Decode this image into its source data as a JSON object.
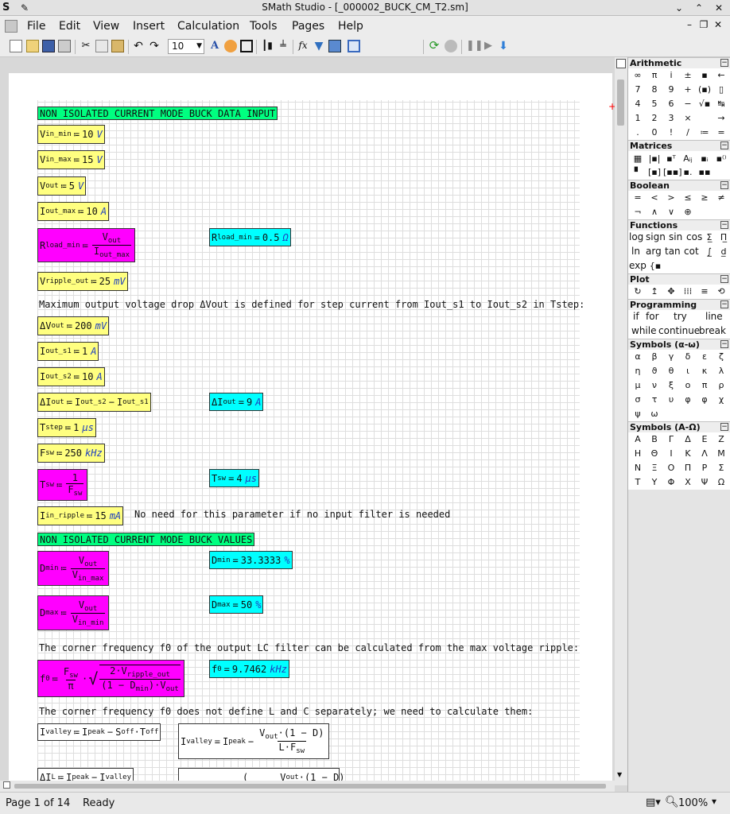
{
  "window": {
    "title": "SMath Studio - [_000002_BUCK_CM_T2.sm]"
  },
  "menu": [
    "File",
    "Edit",
    "View",
    "Insert",
    "Calculation",
    "Tools",
    "Pages",
    "Help"
  ],
  "toolbar": {
    "font_size": "10"
  },
  "sheet": {
    "header1": "NON ISOLATED CURRENT MODE BUCK DATA INPUT",
    "vin_min": {
      "base": "V",
      "sub": "in_min",
      "value": "10",
      "unit": "V"
    },
    "vin_max": {
      "base": "V",
      "sub": "in_max",
      "value": "15",
      "unit": "V"
    },
    "vout": {
      "base": "V",
      "sub": "out",
      "value": "5",
      "unit": "V"
    },
    "iout_max": {
      "base": "I",
      "sub": "out_max",
      "value": "10",
      "unit": "A"
    },
    "rload_def": {
      "base": "R",
      "sub": "load_min",
      "num_b": "V",
      "num_s": "out",
      "den_b": "I",
      "den_s": "out_max"
    },
    "rload_res": {
      "base": "R",
      "sub": "load_min",
      "value": "0.5",
      "unit": "Ω"
    },
    "vripple": {
      "base": "V",
      "sub": "ripple_out",
      "value": "25",
      "unit": "mV"
    },
    "text1": "Maximum output voltage drop ΔVout is defined for step current from Iout_s1 to Iout_s2 in Tstep:",
    "dvout": {
      "base": "ΔV",
      "sub": "out",
      "value": "200",
      "unit": "mV"
    },
    "iout_s1": {
      "base": "I",
      "sub": "out_s1",
      "value": "1",
      "unit": "A"
    },
    "iout_s2": {
      "base": "I",
      "sub": "out_s2",
      "value": "10",
      "unit": "A"
    },
    "diout_def": {
      "base": "ΔI",
      "sub": "out",
      "a_b": "I",
      "a_s": "out_s2",
      "b_b": "I",
      "b_s": "out_s1"
    },
    "diout_res": {
      "base": "ΔI",
      "sub": "out",
      "value": "9",
      "unit": "A"
    },
    "tstep": {
      "base": "T",
      "sub": "step",
      "value": "1",
      "unit": "μs"
    },
    "fsw": {
      "base": "F",
      "sub": "sw",
      "value": "250",
      "unit": "kHz"
    },
    "tsw_def": {
      "base": "T",
      "sub": "sw",
      "num": "1",
      "den_b": "F",
      "den_s": "sw"
    },
    "tsw_res": {
      "base": "T",
      "sub": "sw",
      "value": "4",
      "unit": "μs"
    },
    "iin_ripple": {
      "base": "I",
      "sub": "in_ripple",
      "value": "15",
      "unit": "mA"
    },
    "text2": "No need for this parameter if no input filter is needed",
    "header2": "NON ISOLATED CURRENT MODE BUCK VALUES",
    "dmin_def": {
      "base": "D",
      "sub": "min",
      "num_b": "V",
      "num_s": "out",
      "den_b": "V",
      "den_s": "in_max"
    },
    "dmin_res": {
      "base": "D",
      "sub": "min",
      "value": "33.3333",
      "unit": "%"
    },
    "dmax_def": {
      "base": "D",
      "sub": "max",
      "num_b": "V",
      "num_s": "out",
      "den_b": "V",
      "den_s": "in_min"
    },
    "dmax_res": {
      "base": "D",
      "sub": "max",
      "value": "50",
      "unit": "%"
    },
    "text3": "The corner frequency f0 of the output LC filter can be calculated from the max voltage ripple:",
    "f0_def": {
      "base": "f",
      "sub": "0",
      "fnum_b": "F",
      "fnum_s": "sw",
      "fden": "π",
      "rnum": "2·V",
      "rnum_s": "ripple_out",
      "rden1": "(1 − D",
      "rden1_s": "min",
      "rden2": ")·V",
      "rden2_s": "out"
    },
    "f0_res": {
      "base": "f",
      "sub": "0",
      "value": "9.7462",
      "unit": "kHz"
    },
    "text4": "The corner frequency f0 does not define L and C separately; we need to calculate them:",
    "ivalley": {
      "base": "I",
      "sub": "valley",
      "a_b": "I",
      "a_s": "peak",
      "b_b": "S",
      "b_s": "off",
      "c_b": "T",
      "c_s": "off"
    },
    "ivalley2": {
      "base": "I",
      "sub": "valley",
      "a_b": "I",
      "a_s": "peak",
      "num": "V",
      "num_s": "out",
      "num_tail": "·(1 − D)",
      "den": "L·F",
      "den_s": "sw"
    },
    "dil": {
      "base": "ΔI",
      "sub": "L",
      "a_b": "I",
      "a_s": "peak",
      "b_b": "I",
      "b_s": "valley"
    },
    "partial": {
      "num": "V",
      "num_s": "out",
      "tail": "·(1 − D)"
    }
  },
  "panels": {
    "arithmetic": {
      "title": "Arithmetic",
      "symbols": [
        "∞",
        "π",
        "i",
        "±",
        "▪",
        "←",
        "7",
        "8",
        "9",
        "+",
        "(▪)",
        "▯",
        "4",
        "5",
        "6",
        "−",
        "√▪",
        "↹",
        "1",
        "2",
        "3",
        "×",
        "",
        "→",
        ".",
        "0",
        "!",
        "/",
        "≔",
        "="
      ]
    },
    "matrices": {
      "title": "Matrices"
    },
    "boolean": {
      "title": "Boolean",
      "symbols": [
        "=",
        "<",
        ">",
        "≤",
        "≥",
        "≠",
        "¬",
        "∧",
        "∨",
        "⊕"
      ]
    },
    "functions": {
      "title": "Functions",
      "words": [
        "log",
        "sign",
        "sin",
        "cos",
        "ln",
        "arg",
        "tan",
        "cot",
        "exp"
      ]
    },
    "plot": {
      "title": "Plot"
    },
    "programming": {
      "title": "Programming",
      "words": [
        "if",
        "for",
        "try",
        "line",
        "while",
        "continue",
        "break"
      ]
    },
    "greek_lower": {
      "title": "Symbols (α-ω)",
      "symbols": [
        "α",
        "β",
        "γ",
        "δ",
        "ε",
        "ζ",
        "η",
        "ϑ",
        "θ",
        "ι",
        "κ",
        "λ",
        "μ",
        "ν",
        "ξ",
        "ο",
        "π",
        "ρ",
        "σ",
        "τ",
        "υ",
        "φ",
        "φ",
        "χ",
        "ψ",
        "ω"
      ]
    },
    "greek_upper": {
      "title": "Symbols (Α-Ω)",
      "symbols": [
        "Α",
        "Β",
        "Γ",
        "Δ",
        "Ε",
        "Ζ",
        "Η",
        "Θ",
        "Ι",
        "Κ",
        "Λ",
        "Μ",
        "Ν",
        "Ξ",
        "Ο",
        "Π",
        "Ρ",
        "Σ",
        "Τ",
        "Υ",
        "Φ",
        "Χ",
        "Ψ",
        "Ω"
      ]
    }
  },
  "status": {
    "page": "Page 1 of 14",
    "state": "Ready",
    "zoom": "100%"
  }
}
